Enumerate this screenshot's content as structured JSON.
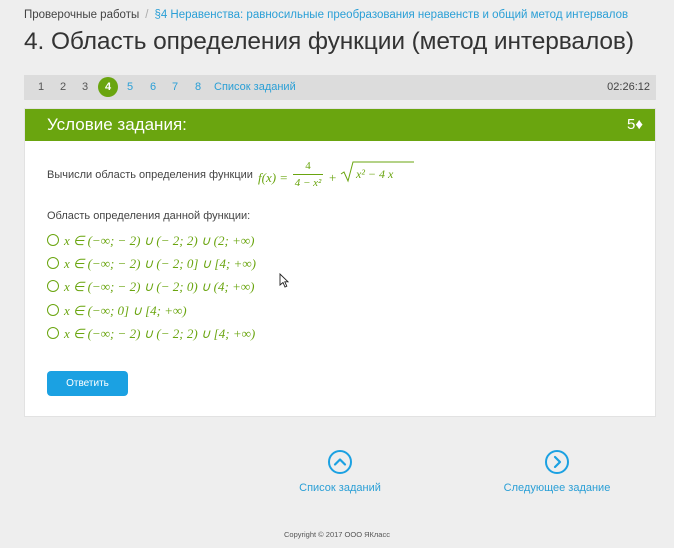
{
  "breadcrumb": {
    "root": "Проверочные работы",
    "separator": "/",
    "section": "§4 Неравенства: равносильные преобразования неравенств и общий метод интервалов"
  },
  "page_title": "4. Область определения функции (метод интервалов)",
  "pager": {
    "numbers": [
      "1",
      "2",
      "3",
      "4",
      "5",
      "6",
      "7",
      "8"
    ],
    "active": "4",
    "task_list_label": "Список заданий",
    "timer": "02:26:12"
  },
  "task": {
    "header_title": "Условие задания:",
    "points": "5♦",
    "prompt": "Вычисли область определения функции",
    "formula": {
      "lhs": "f(x) =",
      "numerator": "4",
      "denominator": "4 − x²",
      "plus": "+",
      "radicand": "x² − 4 x"
    },
    "subquestion": "Область определения данной функции:",
    "options": [
      "x ∈ (−∞; − 2) ∪ (− 2; 2) ∪ (2; +∞)",
      "x ∈ (−∞; − 2) ∪ (− 2; 0] ∪ [4; +∞)",
      "x ∈ (−∞; − 2) ∪ (− 2; 0) ∪ (4; +∞)",
      "x ∈ (−∞; 0] ∪ [4; +∞)",
      "x ∈ (−∞; − 2) ∪ (− 2; 2) ∪ [4; +∞)"
    ],
    "answer_button": "Ответить"
  },
  "bottom_nav": {
    "task_list": "Список заданий",
    "next_task": "Следующее задание"
  },
  "copyright": "Copyright © 2017 ООО ЯКласс",
  "colors": {
    "accent_green": "#6aa50f",
    "accent_blue": "#1ba1e2",
    "link_blue": "#2a9fd6"
  },
  "icons": {
    "task_list": "chevron-up-circle-icon",
    "next_task": "chevron-right-circle-icon"
  }
}
